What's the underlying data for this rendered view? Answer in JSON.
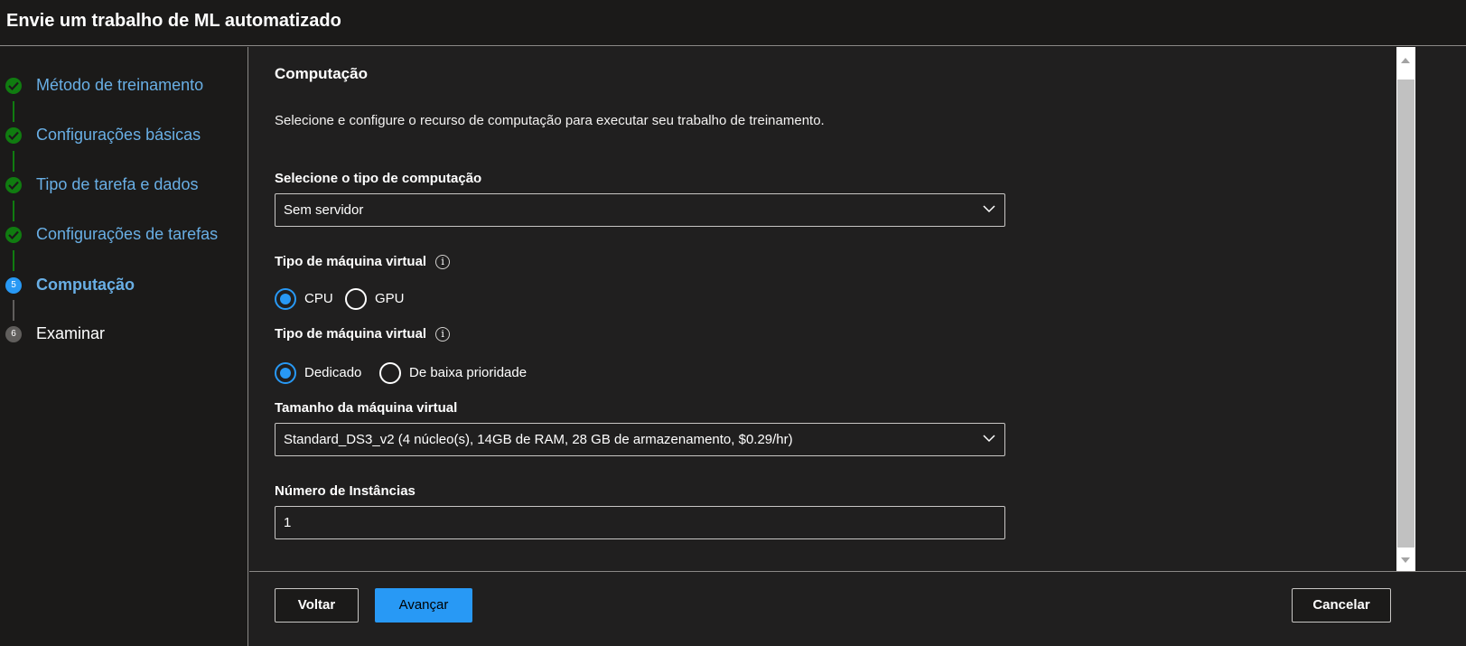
{
  "window": {
    "title": "Envie um trabalho de ML automatizado"
  },
  "sidebar": {
    "steps": [
      {
        "label": "Método de treinamento",
        "status": "done"
      },
      {
        "label": "Configurações básicas",
        "status": "done"
      },
      {
        "label": "Tipo de tarefa e dados",
        "status": "done"
      },
      {
        "label": "Configurações de tarefas",
        "status": "done"
      },
      {
        "label": "Computação",
        "status": "current",
        "number": "5"
      },
      {
        "label": "Examinar",
        "status": "pending",
        "number": "6"
      }
    ]
  },
  "main": {
    "section_title": "Computação",
    "description": "Selecione e configure o recurso de computação para executar seu trabalho de treinamento.",
    "compute_type": {
      "label": "Selecione o tipo de computação",
      "value": "Sem servidor"
    },
    "vm_type": {
      "label": "Tipo de máquina virtual",
      "info_icon": "i",
      "options": [
        "CPU",
        "GPU"
      ],
      "selected": "CPU"
    },
    "vm_priority": {
      "label": "Tipo de máquina virtual",
      "info_icon": "i",
      "options": [
        "Dedicado",
        "De baixa prioridade"
      ],
      "selected": "Dedicado"
    },
    "vm_size": {
      "label": "Tamanho da máquina virtual",
      "value": "Standard_DS3_v2 (4 núcleo(s), 14GB de RAM, 28 GB de armazenamento, $0.29/hr)"
    },
    "instances": {
      "label": "Número de Instâncias",
      "value": "1"
    }
  },
  "footer": {
    "back_label": "Voltar",
    "next_label": "Avançar",
    "cancel_label": "Cancelar"
  },
  "colors": {
    "accent": "#2899f5",
    "done": "#107c10",
    "link": "#69afe5",
    "background": "#201f1f"
  }
}
